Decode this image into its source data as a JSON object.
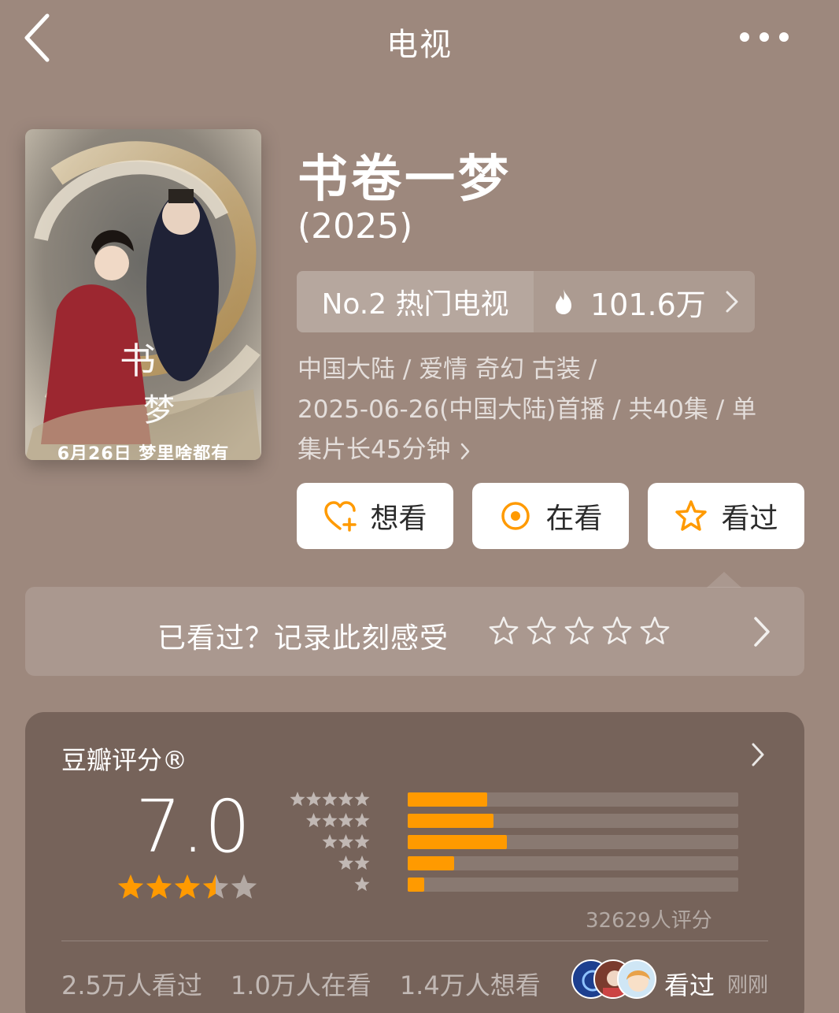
{
  "header": {
    "title": "电视",
    "back_icon": "chevron-left-icon",
    "more_icon": "more-dots-icon"
  },
  "poster": {
    "caption": "6月26日 梦里啥都有"
  },
  "show": {
    "title": "书卷一梦",
    "year": "(2025)"
  },
  "rank": {
    "label": "No.2 热门电视",
    "heat": "101.6万"
  },
  "meta": {
    "line1": "中国大陆 / 爱情 奇幻 古装 /",
    "line2": "2025-06-26(中国大陆)首播 / 共40集 / 单",
    "line3": "集片长45分钟"
  },
  "actions": [
    {
      "label": "想看",
      "icon": "heart-plus-icon"
    },
    {
      "label": "在看",
      "icon": "target-icon"
    },
    {
      "label": "看过",
      "icon": "star-outline-icon"
    }
  ],
  "feel": {
    "prompt": "已看过？记录此刻感受",
    "star_count": 5
  },
  "rating": {
    "label": "豆瓣评分®",
    "score": "7.0",
    "stars_filled": 3.5,
    "distribution": [
      {
        "stars": 5,
        "fraction": 0.24
      },
      {
        "stars": 4,
        "fraction": 0.26
      },
      {
        "stars": 3,
        "fraction": 0.3
      },
      {
        "stars": 2,
        "fraction": 0.14
      },
      {
        "stars": 1,
        "fraction": 0.05
      }
    ],
    "count_text": "32629人评分"
  },
  "stats": {
    "watched": "2.5万人看过",
    "watching": "1.0万人在看",
    "want": "1.4万人想看"
  },
  "friend_activity": {
    "action": "看过",
    "time": "刚刚"
  },
  "colors": {
    "accent": "#ff9a00",
    "background": "#9d887d"
  }
}
